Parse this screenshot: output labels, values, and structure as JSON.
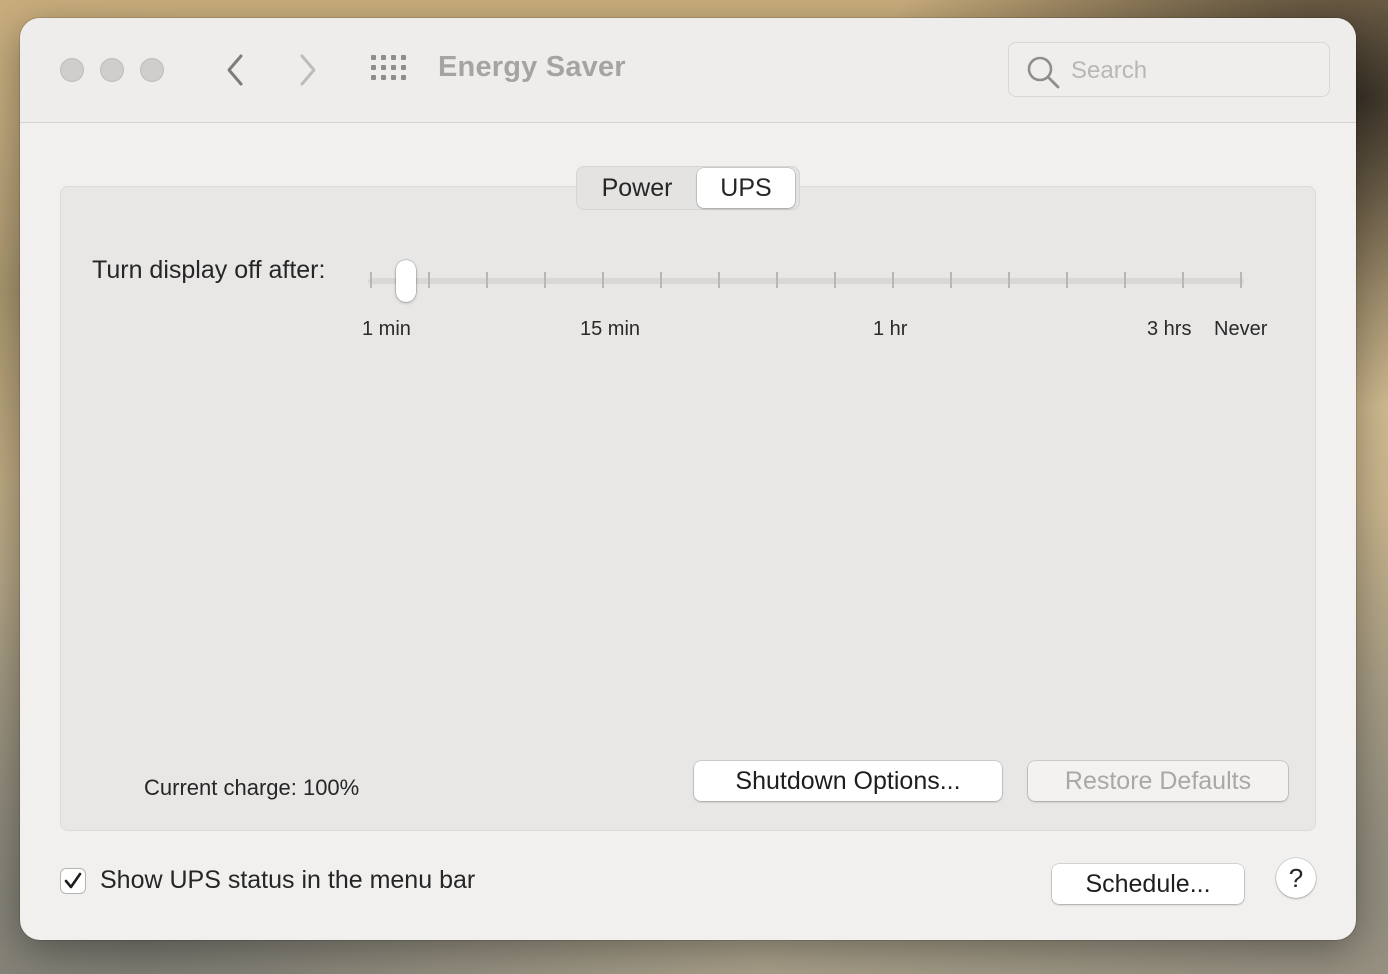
{
  "window": {
    "title": "Energy Saver"
  },
  "titlebar": {
    "traffic_lights": [
      "close-button",
      "minimize-button",
      "zoom-button"
    ],
    "back_icon": "chevron-left-icon",
    "forward_icon": "chevron-right-icon",
    "grid_icon": "show-all-grid-icon"
  },
  "search": {
    "placeholder": "Search",
    "value": "",
    "icon": "search-icon"
  },
  "tabs": [
    {
      "label": "Power",
      "selected": false
    },
    {
      "label": "UPS",
      "selected": true
    }
  ],
  "display_slider": {
    "label": "Turn display off after:",
    "tick_count": 16,
    "selected_tick_index": 0,
    "tick_labels": {
      "min_1": "1 min",
      "min_15": "15 min",
      "hr_1": "1 hr",
      "hrs_3": "3 hrs",
      "never": "Never"
    }
  },
  "status": {
    "current_charge": "Current charge: 100%"
  },
  "buttons": {
    "shutdown_options": "Shutdown Options...",
    "restore_defaults": "Restore Defaults",
    "schedule": "Schedule...",
    "help": "?"
  },
  "checkbox": {
    "label": "Show UPS status in the menu bar",
    "checked": true
  },
  "colors": {
    "window_bg": "#f1f0ef",
    "panel_bg": "#e8e7e6",
    "disabled_text": "#a9a8a7"
  }
}
